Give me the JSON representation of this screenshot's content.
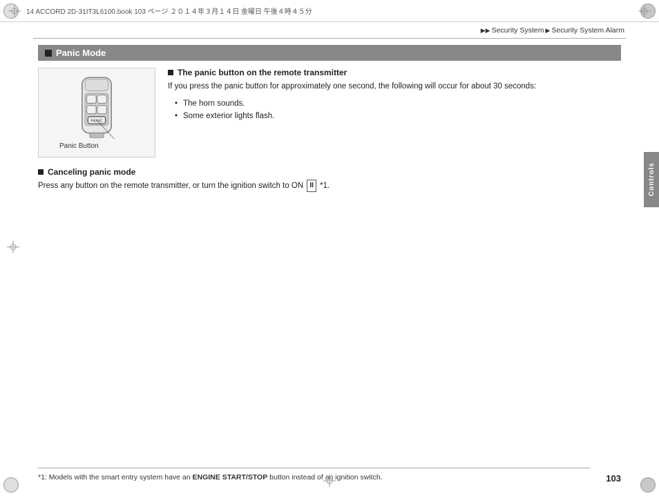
{
  "header": {
    "file_info": "14 ACCORD 2D-31IT3L6100.book  103 ページ  ２０１４年３月１４日  金曜日  午後４時４５分"
  },
  "breadcrumb": {
    "part1": "Security System",
    "part2": "Security System Alarm",
    "arrows": "▶▶"
  },
  "section": {
    "title": "Panic Mode"
  },
  "panic_button_subsection": {
    "title": "The panic button on the remote transmitter",
    "body": "If you press the panic button for approximately one second, the following will occur for about 30 seconds:",
    "bullets": [
      "The horn sounds.",
      "Some exterior lights flash."
    ]
  },
  "image": {
    "label": "Panic Button"
  },
  "canceling": {
    "title": "Canceling panic mode",
    "text_before_badge": "Press any button on the remote transmitter, or turn the ignition switch to ON",
    "badge": "II",
    "text_after_badge": "*1."
  },
  "footer": {
    "note": "*1: Models with the smart entry system have an ",
    "bold_part": "ENGINE START/STOP",
    "note_end": " button instead of an ignition switch."
  },
  "page_number": "103",
  "side_tab": "Controls"
}
